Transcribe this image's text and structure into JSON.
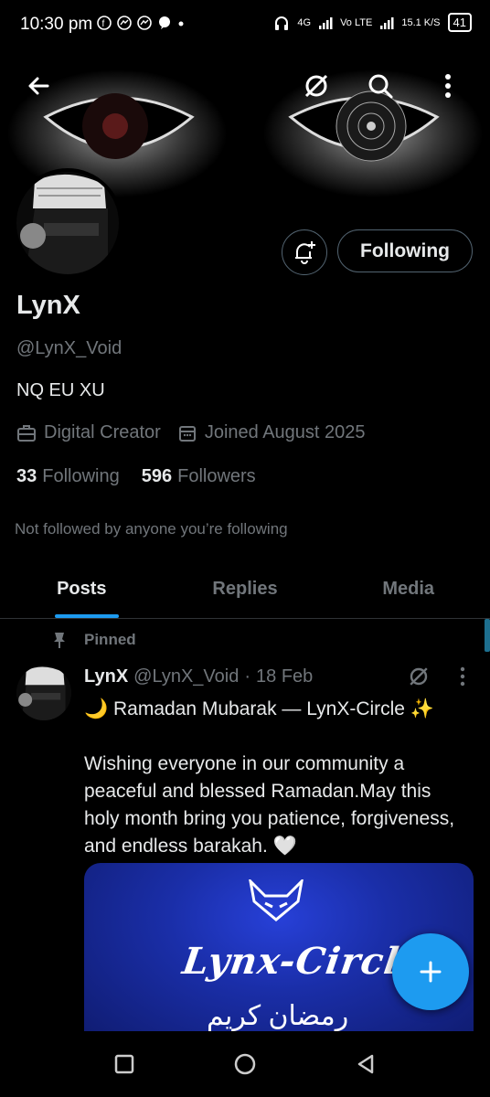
{
  "status_bar": {
    "time": "10:30 pm",
    "network_gen": "4G",
    "volte": "Vo LTE",
    "speed": "15.1 K/S",
    "battery": "41"
  },
  "header": {
    "back_icon": "arrow-left-icon",
    "actions": [
      "hide-icon",
      "search-icon",
      "more-vertical-icon"
    ]
  },
  "profile": {
    "name": "LynX",
    "handle": "@LynX_Void",
    "bio": "NQ EU XU",
    "category": "Digital Creator",
    "joined": "Joined August 2025",
    "following_count": "33",
    "following_label": "Following",
    "followers_count": "596",
    "followers_label": "Followers",
    "not_followed": "Not followed by anyone you’re following",
    "follow_button": "Following"
  },
  "tabs": [
    {
      "label": "Posts",
      "active": true
    },
    {
      "label": "Replies",
      "active": false
    },
    {
      "label": "Media",
      "active": false
    }
  ],
  "post": {
    "pinned_label": "Pinned",
    "author": "LynX",
    "handle": "@LynX_Void",
    "sep": "·",
    "date": "18 Feb",
    "text": "🌙 Ramadan Mubarak — LynX-Circle ✨\n\nWishing everyone in our community a peaceful and blessed Ramadan.May this holy month bring you patience, forgiveness, and endless barakah. 🤍",
    "media_title": "Lynx-Circle",
    "media_subtitle": "رمضان كريم"
  },
  "colors": {
    "accent": "#1d9bf0",
    "muted": "#71767b",
    "text": "#e7e9ea",
    "background": "#000000"
  }
}
